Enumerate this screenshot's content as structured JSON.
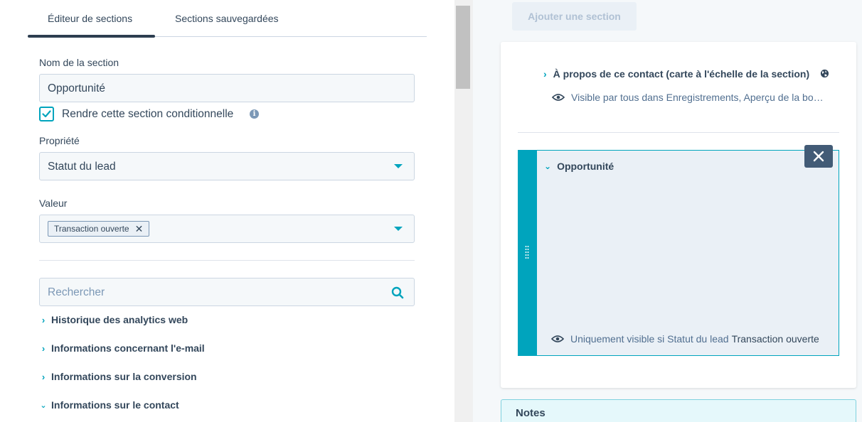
{
  "tabs": {
    "editor": "Éditeur de sections",
    "saved": "Sections sauvegardées"
  },
  "form": {
    "section_name_label": "Nom de la section",
    "section_name_value": "Opportunité",
    "conditional_label": "Rendre cette section conditionnelle",
    "conditional_checked": true,
    "property_label": "Propriété",
    "property_value": "Statut du lead",
    "value_label": "Valeur",
    "value_tag": "Transaction ouverte",
    "search_placeholder": "Rechercher"
  },
  "property_groups": [
    {
      "label": "Historique des analytics web",
      "expanded": false
    },
    {
      "label": "Informations concernant l'e-mail",
      "expanded": false
    },
    {
      "label": "Informations sur la conversion",
      "expanded": false
    },
    {
      "label": "Informations sur le contact",
      "expanded": true
    }
  ],
  "preview": {
    "add_section_label": "Ajouter une section",
    "section1": {
      "title": "À propos de ce contact (carte à l'échelle de la section)",
      "visibility": "Visible par tous dans Enregistrements, Aperçu de la bo…"
    },
    "section2": {
      "title": "Opportunité",
      "visibility_prefix": "Uniquement visible si Statut du lead",
      "visibility_value": "Transaction ouverte"
    },
    "notes_label": "Notes"
  },
  "colors": {
    "accent": "#00a4bd",
    "text": "#33475b",
    "dark_button": "#425b76"
  }
}
